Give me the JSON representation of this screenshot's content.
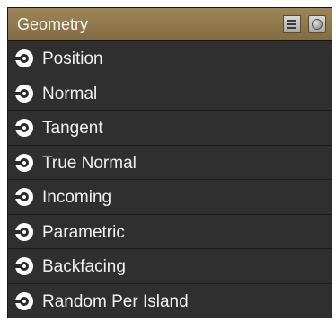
{
  "node": {
    "title": "Geometry",
    "header_buttons": [
      {
        "icon": "list-icon"
      },
      {
        "icon": "sphere-preview-icon"
      }
    ],
    "colors": {
      "header": "#927850",
      "body": "#2b2b2b",
      "socket": "#ffffff",
      "text": "#f0f0f0"
    },
    "outputs": [
      {
        "label": "Position"
      },
      {
        "label": "Normal"
      },
      {
        "label": "Tangent"
      },
      {
        "label": "True Normal"
      },
      {
        "label": "Incoming"
      },
      {
        "label": "Parametric"
      },
      {
        "label": "Backfacing"
      },
      {
        "label": "Random Per Island"
      }
    ]
  }
}
